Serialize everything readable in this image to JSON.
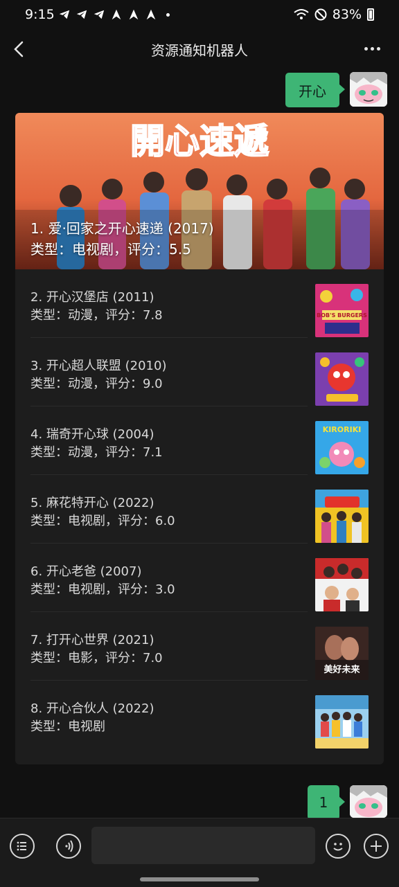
{
  "status_bar": {
    "time": "9:15",
    "battery": "83%"
  },
  "header": {
    "title": "资源通知机器人"
  },
  "messages": {
    "first_user": "开心",
    "second_user": "1"
  },
  "results": {
    "featured": {
      "title": "1. 爱·回家之开心速递 (2017)",
      "subtitle": "类型：电视剧，评分：5.5",
      "banner_text": "開心速遞"
    },
    "items": [
      {
        "title": "2. 开心汉堡店 (2011)",
        "subtitle": "类型：动漫，评分：7.8",
        "thumb_text": "BOB'S BURGERS",
        "thumb_color": "#d8327a"
      },
      {
        "title": "3. 开心超人联盟 (2010)",
        "subtitle": "类型：动漫，评分：9.0",
        "thumb_text": "",
        "thumb_color": "#7b3fae"
      },
      {
        "title": "4. 瑞奇开心球 (2004)",
        "subtitle": "类型：动漫，评分：7.1",
        "thumb_text": "KIRORIKI",
        "thumb_color": "#35a7e8"
      },
      {
        "title": "5. 麻花特开心 (2022)",
        "subtitle": "类型：电视剧，评分：6.0",
        "thumb_text": "",
        "thumb_color": "#f0c324"
      },
      {
        "title": "6. 开心老爸 (2007)",
        "subtitle": "类型：电视剧，评分：3.0",
        "thumb_text": "",
        "thumb_color": "#c92b2b"
      },
      {
        "title": "7. 打开心世界 (2021)",
        "subtitle": "类型：电影，评分：7.0",
        "thumb_text": "美好未来",
        "thumb_color": "#3a2622"
      },
      {
        "title": "8. 开心合伙人 (2022)",
        "subtitle": "类型：电视剧",
        "thumb_text": "",
        "thumb_color": "#4a9bd0"
      }
    ]
  },
  "colors": {
    "bubble": "#3eb575",
    "background": "#111111",
    "card": "#1d1d1d"
  },
  "icons": [
    "telegram-icon",
    "arrow-icon",
    "wifi-icon",
    "dnd-icon",
    "battery-icon",
    "back-icon",
    "more-icon",
    "menu-list-icon",
    "voice-icon",
    "emoji-icon",
    "plus-icon"
  ]
}
